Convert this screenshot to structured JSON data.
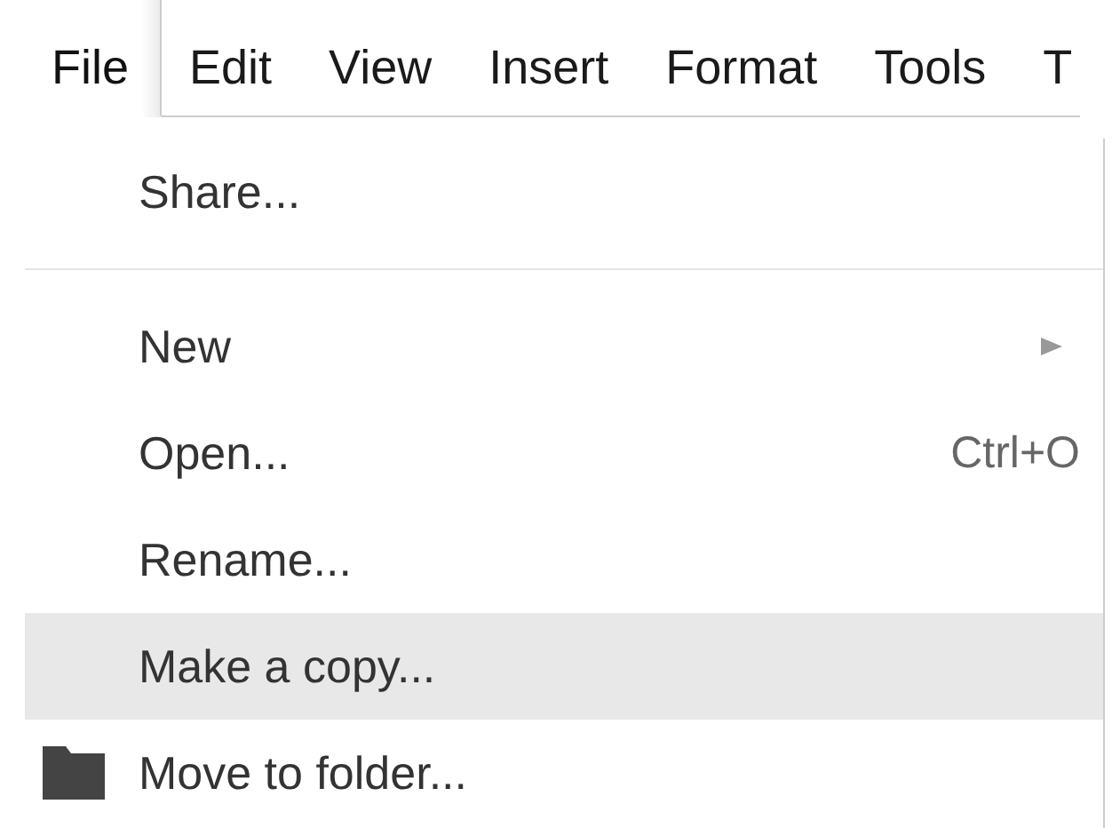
{
  "menu_bar": [
    {
      "label": "File",
      "selected": true
    },
    {
      "label": "Edit",
      "selected": false
    },
    {
      "label": "View",
      "selected": false
    },
    {
      "label": "Insert",
      "selected": false
    },
    {
      "label": "Format",
      "selected": false
    },
    {
      "label": "Tools",
      "selected": false
    },
    {
      "label": "T",
      "selected": false
    }
  ],
  "file_menu": [
    {
      "kind": "item",
      "label": "Share...",
      "selected": false,
      "submenu": false,
      "icon": false
    },
    {
      "kind": "separator"
    },
    {
      "kind": "item",
      "label": "New",
      "selected": false,
      "submenu": true,
      "icon": false
    },
    {
      "kind": "item",
      "label": "Open...",
      "shortcut": "Ctrl+O",
      "selected": false,
      "submenu": false,
      "icon": false
    },
    {
      "kind": "item",
      "label": "Rename...",
      "selected": false,
      "submenu": false,
      "icon": false
    },
    {
      "kind": "item",
      "label": "Make a copy...",
      "selected": true,
      "submenu": false,
      "icon": false
    },
    {
      "kind": "item",
      "label": "Move to folder...",
      "selected": false,
      "submenu": false,
      "icon": true
    }
  ]
}
